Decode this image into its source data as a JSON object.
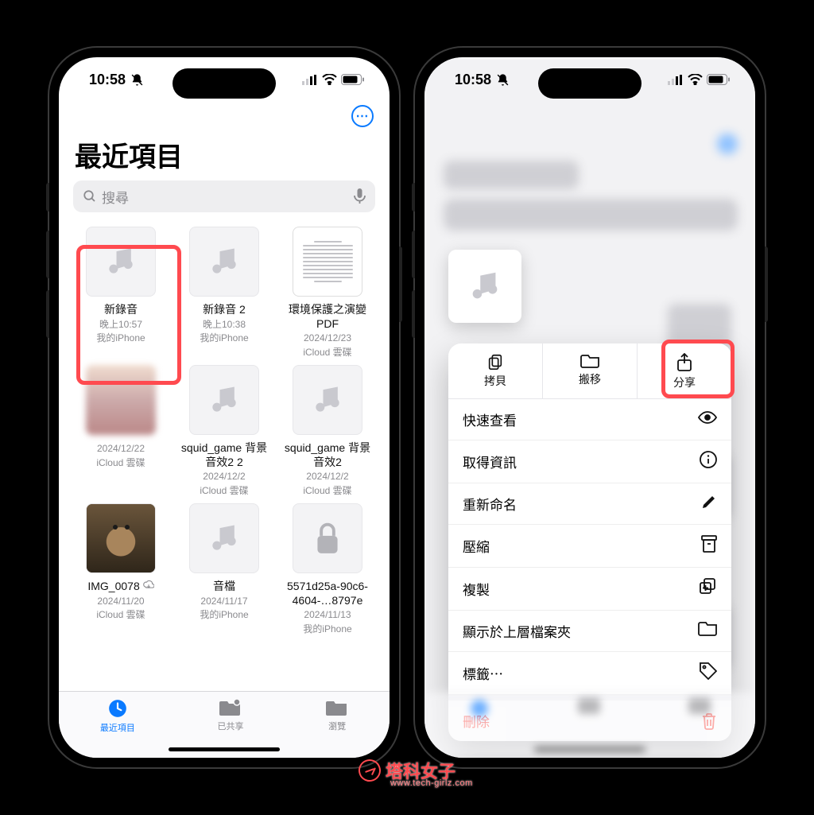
{
  "status": {
    "time": "10:58"
  },
  "colors": {
    "accent": "#0a7aff",
    "highlight": "#ff4a4f",
    "danger": "#ff3b30"
  },
  "phone1": {
    "title": "最近項目",
    "search_placeholder": "搜尋",
    "files": [
      {
        "name": "新錄音",
        "line2": "晚上10:57",
        "line3": "我的iPhone",
        "kind": "audio",
        "highlighted": true
      },
      {
        "name": "新錄音 2",
        "line2": "晚上10:38",
        "line3": "我的iPhone",
        "kind": "audio"
      },
      {
        "name": "環境保護之演變PDF",
        "line2": "2024/12/23",
        "line3": "iCloud 雲碟",
        "kind": "doc"
      },
      {
        "name": "",
        "line2": "2024/12/22",
        "line3": "iCloud 雲碟",
        "kind": "blurred"
      },
      {
        "name": "squid_game 背景音效2 2",
        "line2": "2024/12/2",
        "line3": "iCloud 雲碟",
        "kind": "audio"
      },
      {
        "name": "squid_game 背景音效2",
        "line2": "2024/12/2",
        "line3": "iCloud 雲碟",
        "kind": "audio"
      },
      {
        "name": "IMG_0078",
        "line2": "2024/11/20",
        "line3": "iCloud 雲碟",
        "kind": "photo",
        "cloud": true
      },
      {
        "name": "音檔",
        "line2": "2024/11/17",
        "line3": "我的iPhone",
        "kind": "audio"
      },
      {
        "name": "5571d25a-90c6-4604-…8797e",
        "line2": "2024/11/13",
        "line3": "我的iPhone",
        "kind": "lock"
      }
    ],
    "tabs": [
      {
        "label": "最近項目",
        "icon": "clock",
        "active": true
      },
      {
        "label": "已共享",
        "icon": "folder-person"
      },
      {
        "label": "瀏覽",
        "icon": "folder"
      }
    ]
  },
  "phone2": {
    "top_actions": [
      {
        "label": "拷貝",
        "icon": "copy"
      },
      {
        "label": "搬移",
        "icon": "folder"
      },
      {
        "label": "分享",
        "icon": "share",
        "highlighted": true
      }
    ],
    "rows": [
      {
        "label": "快速查看",
        "icon": "eye"
      },
      {
        "label": "取得資訊",
        "icon": "info"
      },
      {
        "label": "重新命名",
        "icon": "pencil"
      },
      {
        "label": "壓縮",
        "icon": "archive"
      },
      {
        "label": "複製",
        "icon": "duplicate"
      },
      {
        "label": "顯示於上層檔案夾",
        "icon": "folder"
      },
      {
        "label": "標籤⋯",
        "icon": "tag"
      }
    ],
    "delete_label": "刪除"
  },
  "watermark": {
    "brand": "塔科女子",
    "url": "www.tech-girlz.com"
  }
}
